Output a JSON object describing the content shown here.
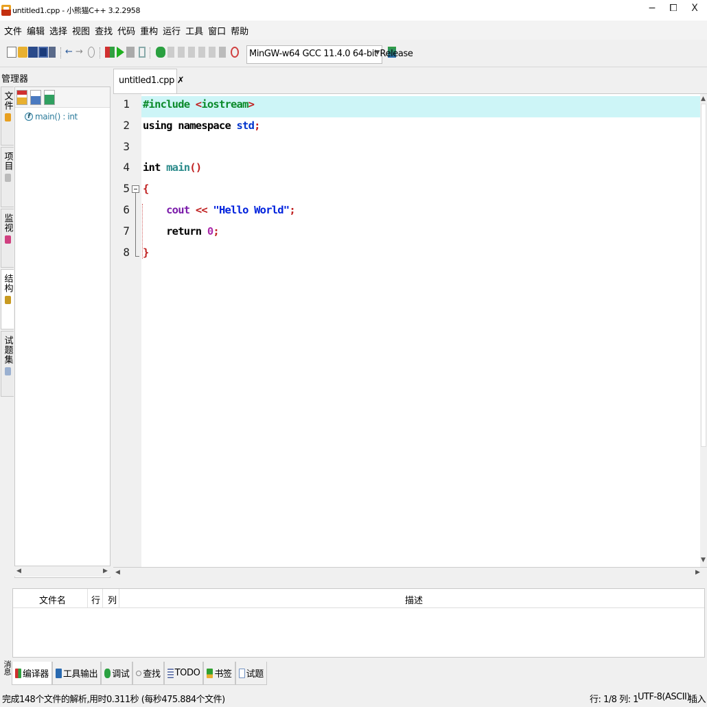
{
  "window": {
    "title": "untitled1.cpp - 小熊猫C++ 3.2.2958",
    "minimize": "−",
    "restore": "⧠",
    "close": "X"
  },
  "menu": [
    "文件",
    "编辑",
    "选择",
    "视图",
    "查找",
    "代码",
    "重构",
    "运行",
    "工具",
    "窗口",
    "帮助"
  ],
  "toolbar": {
    "compiler": "MinGW-w64 GCC 11.4.0 64-bit Release",
    "undo": "←",
    "redo": "→"
  },
  "manager": {
    "title": "管理器",
    "side_tabs": [
      "文件",
      "项目",
      "监视",
      "结构",
      "试题集"
    ],
    "active_tab": "结构",
    "tree": [
      {
        "badge": "f",
        "label": "main() : int"
      }
    ]
  },
  "editor": {
    "tab_label": "untitled1.cpp",
    "tab_close": "✗",
    "current_line": 1,
    "lines": [
      {
        "n": "1",
        "tokens": [
          {
            "t": "#include ",
            "c": "#0a8a2a"
          },
          {
            "t": "<",
            "c": "#c02020"
          },
          {
            "t": "iostream",
            "c": "#0a8a2a"
          },
          {
            "t": ">",
            "c": "#c02020"
          }
        ]
      },
      {
        "n": "2",
        "tokens": [
          {
            "t": "using namespace ",
            "c": "#000000"
          },
          {
            "t": "std",
            "c": "#0033cc"
          },
          {
            "t": ";",
            "c": "#c02020"
          }
        ]
      },
      {
        "n": "3",
        "tokens": []
      },
      {
        "n": "4",
        "tokens": [
          {
            "t": "int ",
            "c": "#000000"
          },
          {
            "t": "main",
            "c": "#2a8a8a"
          },
          {
            "t": "()",
            "c": "#c02020"
          }
        ]
      },
      {
        "n": "5",
        "tokens": [
          {
            "t": "{",
            "c": "#c02020"
          }
        ]
      },
      {
        "n": "6",
        "tokens": [
          {
            "t": "    ",
            "c": "#000000"
          },
          {
            "t": "cout ",
            "c": "#7a1aaa"
          },
          {
            "t": "<< ",
            "c": "#c02020"
          },
          {
            "t": "\"Hello World\"",
            "c": "#0022dd"
          },
          {
            "t": ";",
            "c": "#c02020"
          }
        ]
      },
      {
        "n": "7",
        "tokens": [
          {
            "t": "    ",
            "c": "#000000"
          },
          {
            "t": "return ",
            "c": "#000000"
          },
          {
            "t": "0",
            "c": "#aa2aaa"
          },
          {
            "t": ";",
            "c": "#c02020"
          }
        ]
      },
      {
        "n": "8",
        "tokens": [
          {
            "t": "}",
            "c": "#c02020"
          }
        ]
      }
    ]
  },
  "messages": {
    "columns": [
      "文件名",
      "行",
      "列",
      "描述"
    ]
  },
  "bottom": {
    "side_label": "消息",
    "tabs": [
      {
        "label": "编译器",
        "icon": "compiler-icon",
        "color": "#d03030"
      },
      {
        "label": "工具输出",
        "icon": "tool-output-icon",
        "color": "#2a6ab0"
      },
      {
        "label": "调试",
        "icon": "debug-icon",
        "color": "#2aa040"
      },
      {
        "label": "查找",
        "icon": "search-icon",
        "color": "#888888"
      },
      {
        "label": "TODO",
        "icon": "todo-icon",
        "color": "#7080b0"
      },
      {
        "label": "书签",
        "icon": "bookmark-icon",
        "color": "#30a030"
      },
      {
        "label": "试题",
        "icon": "problem-icon",
        "color": "#7090c0"
      }
    ]
  },
  "status": {
    "message": "完成148个文件的解析,用时0.311秒 (每秒475.884个文件)",
    "position": "行: 1/8 列: 1",
    "encoding": "UTF-8(ASCII)",
    "mode": "插入"
  }
}
